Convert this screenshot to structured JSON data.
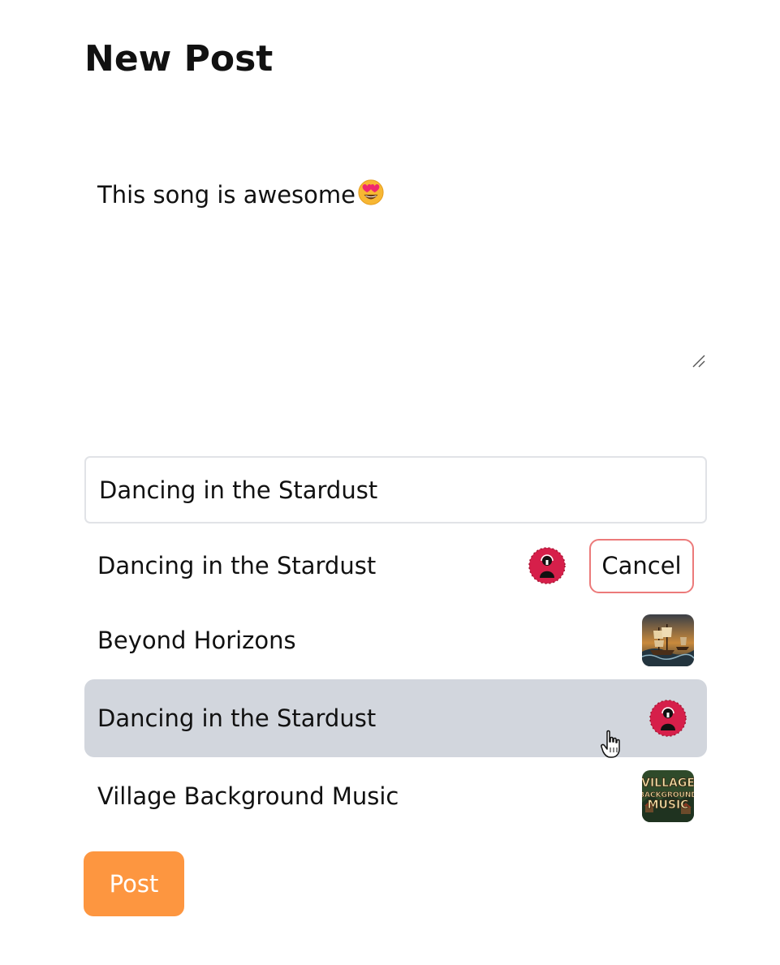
{
  "page": {
    "title": "New Post"
  },
  "composer": {
    "text": "This song is awesome",
    "emoji": "smiling-face-with-heart-eyes"
  },
  "search": {
    "value": "Dancing in the Stardust"
  },
  "selected_song": {
    "title": "Dancing in the Stardust",
    "thumbnail": "red-circle-silhouette-art",
    "cancel_label": "Cancel"
  },
  "results": [
    {
      "title": "Beyond Horizons",
      "thumbnail": "pirate-ship-art"
    },
    {
      "title": "Dancing in the Stardust",
      "thumbnail": "red-circle-silhouette-art",
      "highlighted": true
    },
    {
      "title": "Village Background Music",
      "thumbnail": "village-music-art",
      "thumbnail_text": "VILLAGE BACKGROUND MUSIC"
    }
  ],
  "actions": {
    "post_label": "Post"
  },
  "colors": {
    "post_button": "#fd9640",
    "cancel_border": "#ec7a7a",
    "highlight_row": "#d2d6dd",
    "input_border": "#e1e3e7"
  }
}
